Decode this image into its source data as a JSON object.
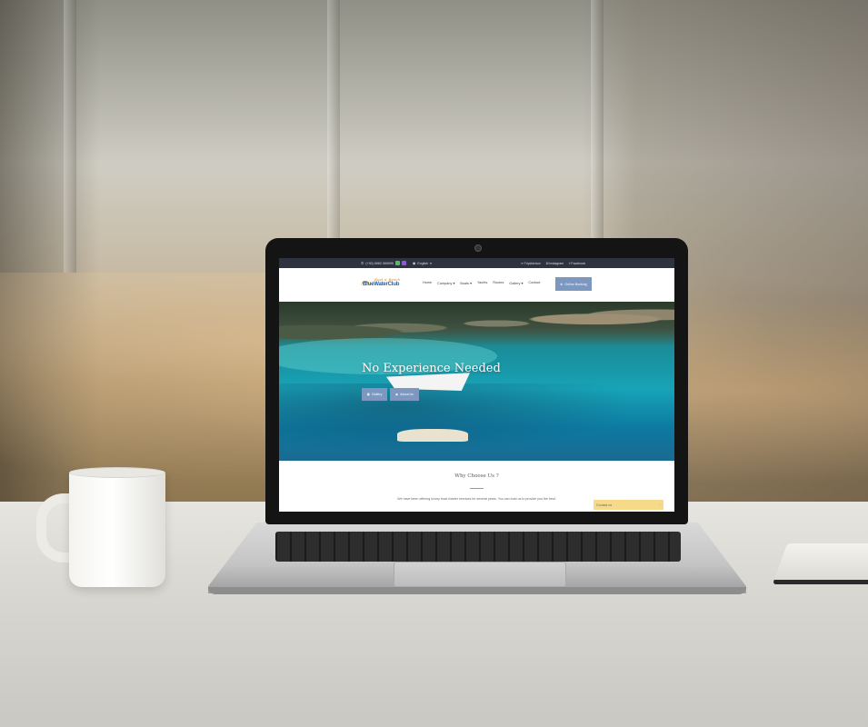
{
  "topbar": {
    "phone": "(+30) 6982 069995",
    "language": "English",
    "links": [
      "TripAdvisor",
      "Instagram",
      "Facebook"
    ]
  },
  "navbar": {
    "logo_main": "BlueWaterClub",
    "logo_tagline": "Boat n' Beach",
    "menu": [
      "Home",
      "Company",
      "Boats",
      "Yachts",
      "Routes",
      "Gallery",
      "Contact"
    ],
    "booking_label": "Online Booking"
  },
  "hero": {
    "title": "No Experience Needed",
    "buttons": [
      "Gallery",
      "About Us"
    ]
  },
  "why": {
    "title": "Why Choose Us ?",
    "text": "We have been offering luxury boat charter services for several years. You can trust us to provide you the best."
  },
  "contact_widget": {
    "label": "Contact us"
  },
  "icons": {
    "phone": "phone-icon",
    "whatsapp": "whatsapp-icon",
    "viber": "viber-icon",
    "flag": "flag-icon",
    "tripadvisor": "tripadvisor-icon",
    "instagram": "instagram-icon",
    "facebook": "facebook-icon"
  },
  "colors": {
    "accent": "#7d98c0",
    "topbar": "#2f3340",
    "contact": "#f7d98a"
  }
}
